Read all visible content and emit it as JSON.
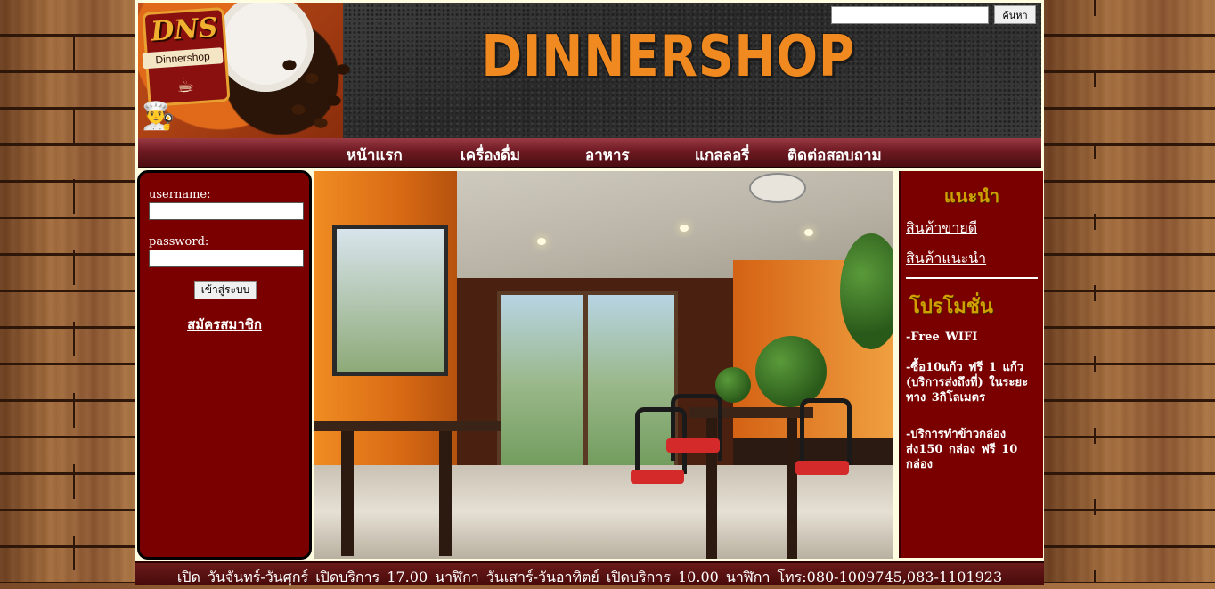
{
  "header": {
    "site_title": "DINNERSHOP",
    "logo_text": "DNS",
    "logo_subtext": "Dinnershop",
    "search": {
      "value": "",
      "placeholder": "",
      "button_label": "ค้นหา"
    }
  },
  "nav": {
    "items": [
      "หน้าแรก",
      "เครื่องดื่ม",
      "อาหาร",
      "แกลลอรี่",
      "ติดต่อสอบถาม"
    ]
  },
  "login": {
    "username_label": "username:",
    "password_label": "password:",
    "username_value": "",
    "password_value": "",
    "login_button": "เข้าสู่ระบบ",
    "register_link": "สมัครสมาชิก"
  },
  "sidebar": {
    "recommend_heading": "แนะนำ",
    "links": [
      "สินค้าขายดี",
      "สินค้าแนะนำ"
    ],
    "promo_heading": "โปรโมชั่น",
    "promos": [
      "-Free WIFI",
      "-ซื้อ10แก้ว ฟรี 1 แก้ว (บริการส่งถึงที่) ในระยะทาง 3กิโลเมตร",
      "-บริการทำข้าวกล่อง ส่ง150 กล่อง ฟรี 10 กล่อง"
    ]
  },
  "footer": {
    "text": "เปิด วันจันทร์-วันศุกร์ เปิดบริการ 17.00 นาฬิกา วันเสาร์-วันอาทิตย์ เปิดบริการ 10.00 นาฬิกา โทร:080-1009745,083-1101923"
  },
  "colors": {
    "panel_bg": "#7a0000",
    "title_orange": "#f08a20",
    "heading_gold": "#d0a000",
    "page_bg": "#fffde0"
  }
}
